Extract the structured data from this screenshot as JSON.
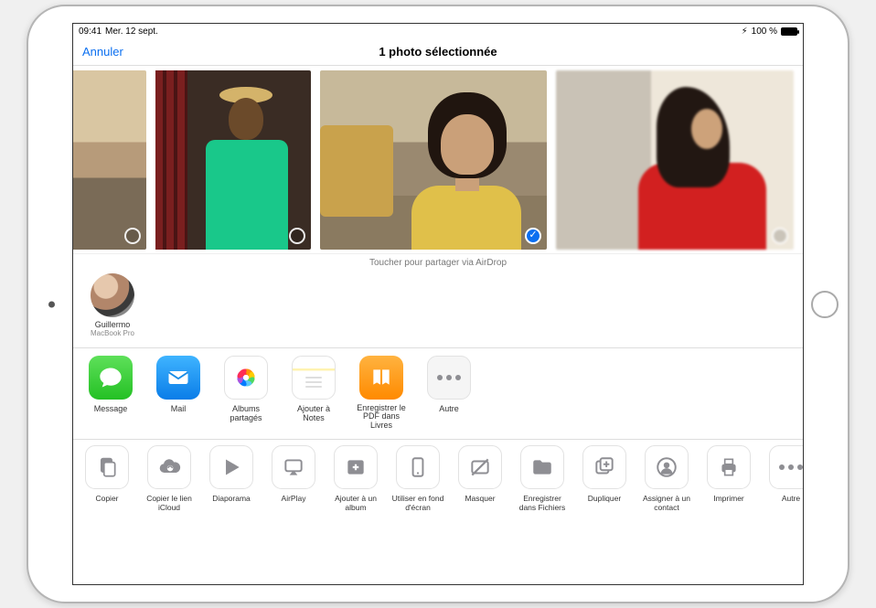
{
  "status": {
    "time": "09:41",
    "date": "Mer. 12 sept.",
    "battery": "100 %"
  },
  "nav": {
    "cancel": "Annuler",
    "title": "1 photo sélectionnée"
  },
  "airdrop": {
    "hint": "Toucher pour partager via AirDrop",
    "contacts": [
      {
        "name": "Guillermo",
        "device": "MacBook Pro"
      }
    ]
  },
  "apps": [
    {
      "key": "message",
      "label": "Message"
    },
    {
      "key": "mail",
      "label": "Mail"
    },
    {
      "key": "shared-albums",
      "label": "Albums partagés"
    },
    {
      "key": "add-notes",
      "label": "Ajouter à Notes"
    },
    {
      "key": "save-pdf-books",
      "label": "Enregistrer le PDF dans Livres"
    },
    {
      "key": "other",
      "label": "Autre"
    }
  ],
  "actions": [
    {
      "key": "copy",
      "label": "Copier"
    },
    {
      "key": "copy-icloud-link",
      "label": "Copier le lien iCloud"
    },
    {
      "key": "slideshow",
      "label": "Diaporama"
    },
    {
      "key": "airplay",
      "label": "AirPlay"
    },
    {
      "key": "add-album",
      "label": "Ajouter à un album"
    },
    {
      "key": "wallpaper",
      "label": "Utiliser en fond d'écran"
    },
    {
      "key": "hide",
      "label": "Masquer"
    },
    {
      "key": "save-files",
      "label": "Enregistrer dans Fichiers"
    },
    {
      "key": "duplicate",
      "label": "Dupliquer"
    },
    {
      "key": "assign-contact",
      "label": "Assigner à un contact"
    },
    {
      "key": "print",
      "label": "Imprimer"
    },
    {
      "key": "more",
      "label": "Autre"
    }
  ]
}
